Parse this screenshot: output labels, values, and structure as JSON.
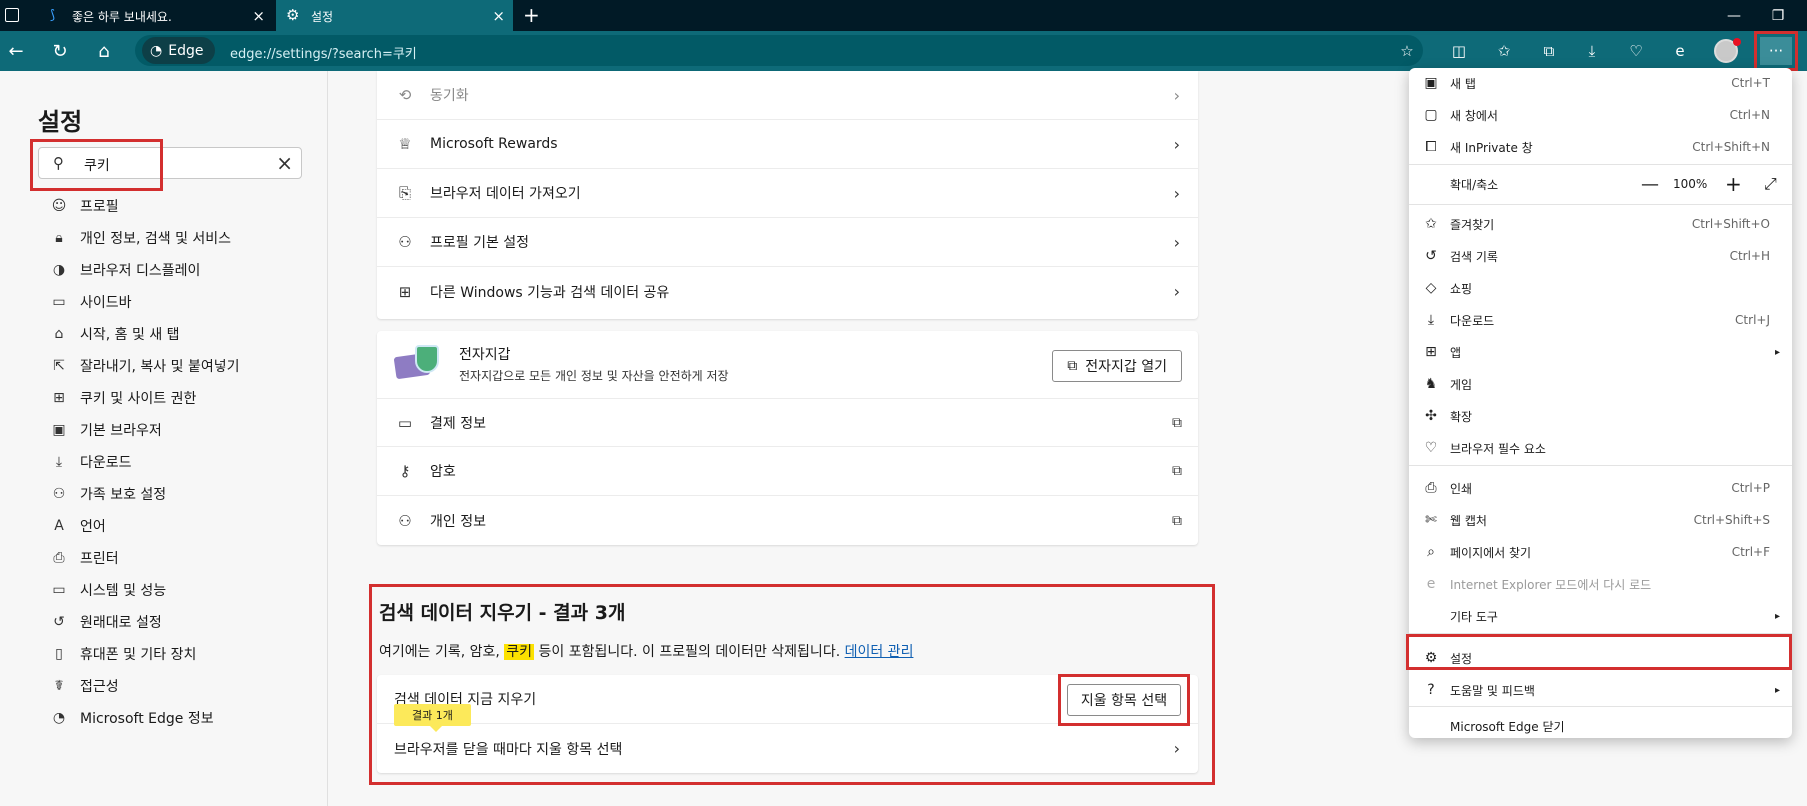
{
  "tabs": [
    {
      "title": "좋은 하루 보내세요.",
      "active": false
    },
    {
      "title": "설정",
      "active": true
    }
  ],
  "addressbar": {
    "browser_label": "Edge",
    "url": "edge://settings/?search=쿠키"
  },
  "sidebar": {
    "title": "설정",
    "search_value": "쿠키",
    "items": [
      {
        "label": "프로필",
        "icon": "profile-icon"
      },
      {
        "label": "개인 정보, 검색 및 서비스",
        "icon": "lock-icon"
      },
      {
        "label": "브라우저 디스플레이",
        "icon": "palette-icon"
      },
      {
        "label": "사이드바",
        "icon": "sidebar-icon"
      },
      {
        "label": "시작, 홈 및 새 탭",
        "icon": "home-icon"
      },
      {
        "label": "잘라내기, 복사 및 붙여넣기",
        "icon": "share-icon"
      },
      {
        "label": "쿠키 및 사이트 권한",
        "icon": "site-permissions-icon"
      },
      {
        "label": "기본 브라우저",
        "icon": "browser-icon"
      },
      {
        "label": "다운로드",
        "icon": "download-icon"
      },
      {
        "label": "가족 보호 설정",
        "icon": "family-icon"
      },
      {
        "label": "언어",
        "icon": "language-icon"
      },
      {
        "label": "프린터",
        "icon": "printer-icon"
      },
      {
        "label": "시스템 및 성능",
        "icon": "laptop-icon"
      },
      {
        "label": "원래대로 설정",
        "icon": "reset-icon"
      },
      {
        "label": "휴대폰 및 기타 장치",
        "icon": "phone-icon"
      },
      {
        "label": "접근성",
        "icon": "accessibility-icon"
      },
      {
        "label": "Microsoft Edge 정보",
        "icon": "edge-icon"
      }
    ]
  },
  "profile_card": {
    "rows": [
      {
        "label": "동기화",
        "icon": "sync-icon",
        "dim": true
      },
      {
        "label": "Microsoft Rewards",
        "icon": "rewards-icon"
      },
      {
        "label": "브라우저 데이터 가져오기",
        "icon": "import-icon"
      },
      {
        "label": "프로필 기본 설정",
        "icon": "profile-settings-icon"
      },
      {
        "label": "다른 Windows 기능과 검색 데이터 공유",
        "icon": "windows-icon"
      }
    ]
  },
  "wallet_card": {
    "title": "전자지갑",
    "subtitle": "전자지갑으로 모든 개인 정보 및 자산을 안전하게 저장",
    "open_button": "전자지갑 열기",
    "rows": [
      {
        "label": "결제 정보",
        "icon": "card-icon"
      },
      {
        "label": "암호",
        "icon": "key-icon"
      },
      {
        "label": "개인 정보",
        "icon": "personal-info-icon"
      }
    ]
  },
  "clear_section": {
    "title": "검색 데이터 지우기 - 결과 3개",
    "desc_before": "여기에는 기록, 암호, ",
    "desc_highlight": "쿠키",
    "desc_after": " 등이 포함됩니다. 이 프로필의 데이터만 삭제됩니다. ",
    "desc_link": "데이터 관리",
    "row1_label": "검색 데이터 지금 지우기",
    "row1_button": "지울 항목 선택",
    "result_tip": "결과 1개",
    "row2_label": "브라우저를 닫을 때마다 지울 항목 선택"
  },
  "menu": {
    "items": [
      {
        "label": "새 탭",
        "shortcut": "Ctrl+T",
        "icon": "new-tab-icon"
      },
      {
        "label": "새 창에서",
        "shortcut": "Ctrl+N",
        "icon": "new-window-icon"
      },
      {
        "label": "새 InPrivate 창",
        "shortcut": "Ctrl+Shift+N",
        "icon": "inprivate-icon"
      },
      {
        "label": "확대/축소",
        "zoom": "100%"
      },
      {
        "label": "즐겨찾기",
        "shortcut": "Ctrl+Shift+O",
        "icon": "favorites-icon"
      },
      {
        "label": "검색 기록",
        "shortcut": "Ctrl+H",
        "icon": "history-icon"
      },
      {
        "label": "쇼핑",
        "shortcut": "",
        "icon": "shopping-icon"
      },
      {
        "label": "다운로드",
        "shortcut": "Ctrl+J",
        "icon": "download-icon"
      },
      {
        "label": "앱",
        "submenu": true,
        "icon": "apps-icon"
      },
      {
        "label": "게임",
        "shortcut": "",
        "icon": "games-icon"
      },
      {
        "label": "확장",
        "shortcut": "",
        "icon": "extensions-icon"
      },
      {
        "label": "브라우저 필수 요소",
        "shortcut": "",
        "icon": "heart-pulse-icon"
      },
      {
        "label": "인쇄",
        "shortcut": "Ctrl+P",
        "icon": "print-icon"
      },
      {
        "label": "웹 캡처",
        "shortcut": "Ctrl+Shift+S",
        "icon": "capture-icon"
      },
      {
        "label": "페이지에서 찾기",
        "shortcut": "Ctrl+F",
        "icon": "find-icon"
      },
      {
        "label": "Internet Explorer 모드에서 다시 로드",
        "shortcut": "",
        "icon": "ie-icon",
        "disabled": true
      },
      {
        "label": "기타 도구",
        "submenu": true
      },
      {
        "label": "설정",
        "shortcut": "",
        "icon": "gear-icon"
      },
      {
        "label": "도움말 및 피드백",
        "submenu": true,
        "icon": "help-icon"
      },
      {
        "label": "Microsoft Edge 닫기"
      }
    ]
  },
  "colors": {
    "titlebar": "#011a26",
    "addressbar": "#0e6a78",
    "highlight_box": "#d32f2f",
    "search_highlight": "#fce100",
    "link": "#0f5fb2"
  }
}
